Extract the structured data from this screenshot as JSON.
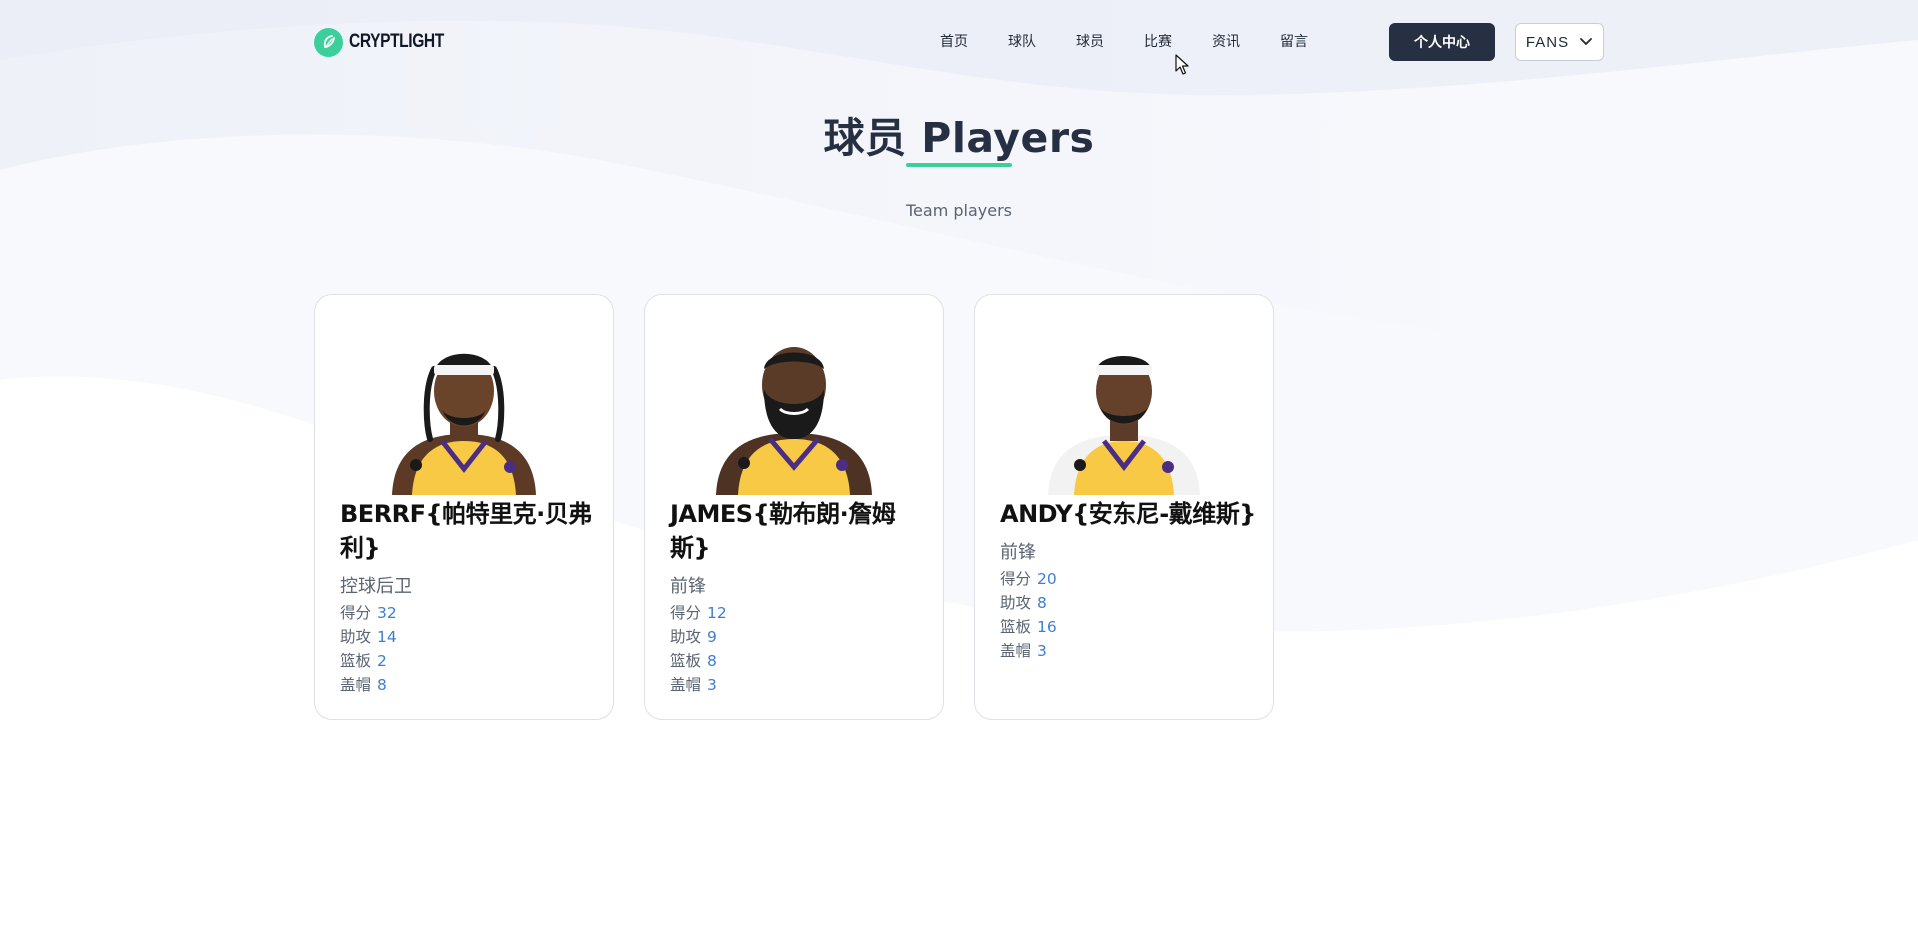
{
  "brand": {
    "name": "CRYPTLIGHT",
    "logo_icon": "leaf-logo-icon",
    "accent": "#3ccf9a"
  },
  "nav": {
    "items": [
      {
        "label": "首页"
      },
      {
        "label": "球队"
      },
      {
        "label": "球员"
      },
      {
        "label": "比赛"
      },
      {
        "label": "资讯"
      },
      {
        "label": "留言"
      }
    ]
  },
  "header": {
    "personal_center_label": "个人中心",
    "fans_label": "FANS",
    "dark_button_color": "#263042"
  },
  "section": {
    "title": "球员 Players",
    "subtitle": "Team players"
  },
  "stat_labels": {
    "points": "得分",
    "assists": "助攻",
    "rebounds": "篮板",
    "blocks": "盖帽"
  },
  "players": [
    {
      "name": "BERRF{帕特里克·贝弗利}",
      "position": "控球后卫",
      "points": "32",
      "assists": "14",
      "rebounds": "2",
      "blocks": "8"
    },
    {
      "name": "JAMES{勒布朗·詹姆斯}",
      "position": "前锋",
      "points": "12",
      "assists": "9",
      "rebounds": "8",
      "blocks": "3"
    },
    {
      "name": "ANDY{安东尼-戴维斯}",
      "position": "前锋",
      "points": "20",
      "assists": "8",
      "rebounds": "16",
      "blocks": "3"
    }
  ],
  "colors": {
    "stat_value": "#3f7fd0",
    "jersey": "#f7c945"
  }
}
